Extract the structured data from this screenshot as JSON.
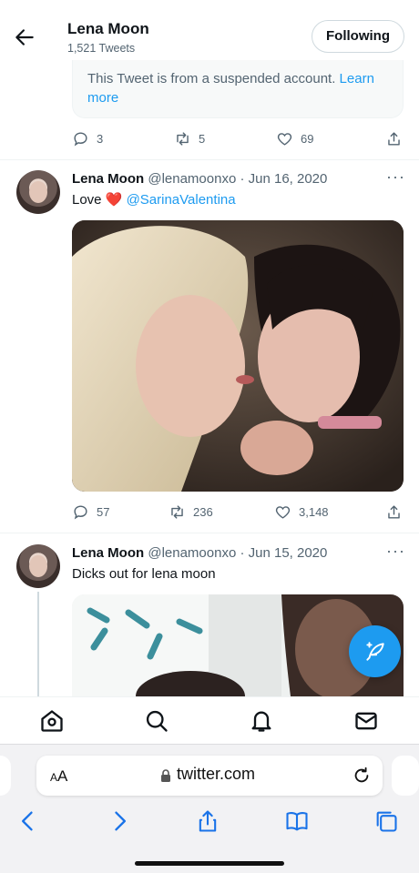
{
  "header": {
    "name": "Lena Moon",
    "tweet_count": "1,521 Tweets",
    "follow_label": "Following"
  },
  "quoted_notice": {
    "text": "This Tweet is from a suspended account.",
    "link": "Learn more"
  },
  "tweet0_actions": {
    "replies": "3",
    "retweets": "5",
    "likes": "69"
  },
  "tweets": [
    {
      "name": "Lena Moon",
      "handle": "@lenamoonxo · Jun 16, 2020",
      "text": "Love",
      "emoji": "❤️",
      "mention": "@SarinaValentina",
      "replies": "57",
      "retweets": "236",
      "likes": "3,148"
    },
    {
      "name": "Lena Moon",
      "handle": "@lenamoonxo · Jun 15, 2020",
      "text": "Dicks out for lena moon"
    }
  ],
  "more_label": "···",
  "nav": {
    "items": [
      "home-icon",
      "search-icon",
      "notifications-icon",
      "messages-icon"
    ]
  },
  "browser": {
    "aa_small": "A",
    "aa_large": "A",
    "url": "twitter.com"
  },
  "colors": {
    "accent": "#1d9bf0",
    "text": "#0f1419",
    "muted": "#536471"
  }
}
